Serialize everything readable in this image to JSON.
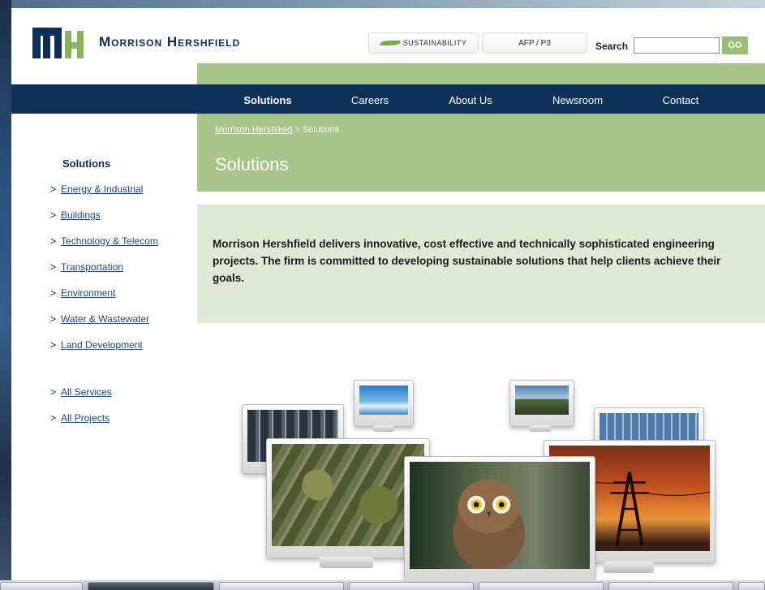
{
  "brand": {
    "company_name": "Morrison Hershfield",
    "colors": {
      "navy": "#0f3158",
      "green": "#a7c58b",
      "light_green": "#dfe9d5"
    }
  },
  "header": {
    "sustainability_label": "Sustainability",
    "afp_label": "AFP / P3",
    "search_label": "Search",
    "search_value": "",
    "go_label": "GO"
  },
  "nav": {
    "items": [
      {
        "label": "Solutions",
        "active": true
      },
      {
        "label": "Careers"
      },
      {
        "label": "About Us"
      },
      {
        "label": "Newsroom"
      },
      {
        "label": "Contact"
      }
    ]
  },
  "breadcrumb": {
    "home": "Morrison Hershfield",
    "separator": ">",
    "current": "Solutions"
  },
  "page": {
    "title": "Solutions",
    "intro": "Morrison Hershfield delivers innovative, cost effective and technically sophisticated engineering projects.  The firm is committed to developing sustainable solutions that help clients achieve their goals."
  },
  "sidebar": {
    "title": "Solutions",
    "marker": ">",
    "items": [
      {
        "label": "Energy & Industrial"
      },
      {
        "label": "Buildings"
      },
      {
        "label": "Technology & Telecom"
      },
      {
        "label": "Transportation"
      },
      {
        "label": "Environment"
      },
      {
        "label": "Water & Wastewater"
      },
      {
        "label": "Land Development"
      },
      {
        "label": "All Services"
      },
      {
        "label": "All Projects"
      }
    ]
  },
  "illustration": {
    "icons": [
      "server-room-icon",
      "sky-icon",
      "road-icon",
      "building-icon",
      "aerial-suburb-icon",
      "owl-icon",
      "power-tower-icon"
    ]
  }
}
